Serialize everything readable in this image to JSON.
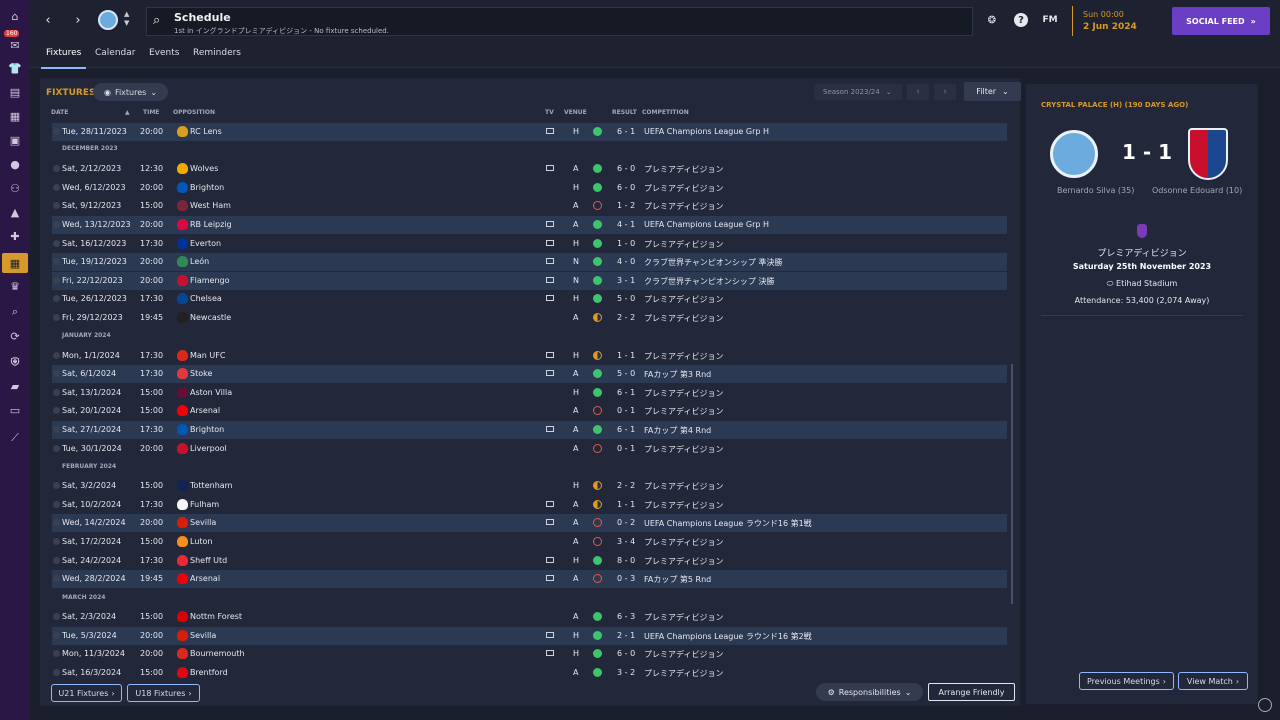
{
  "header": {
    "title": "Schedule",
    "subtitle": "1st in イングランドプレミアディビジョン - No fixture scheduled.",
    "fm_label": "FM",
    "day_time": "Sun 00:00",
    "date": "2 Jun 2024",
    "social_feed": "SOCIAL FEED",
    "inbox_badge": "160"
  },
  "tabs": [
    {
      "label": "Fixtures"
    },
    {
      "label": "Calendar"
    },
    {
      "label": "Events"
    },
    {
      "label": "Reminders"
    }
  ],
  "fixtures": {
    "title": "FIXTURES",
    "view_dropdown": "Fixtures",
    "season": "Season 2023/24",
    "filter": "Filter",
    "columns": {
      "date": "DATE",
      "time": "TIME",
      "opposition": "OPPOSITION",
      "tv": "TV",
      "venue": "VENUE",
      "result": "RESULT",
      "competition": "COMPETITION"
    },
    "months": [
      "DECEMBER 2023",
      "JANUARY 2024",
      "FEBRUARY 2024",
      "MARCH 2024"
    ],
    "rows": [
      {
        "date": "Tue, 28/11/2023",
        "time": "20:00",
        "opp": "RC Lens",
        "venue": "H",
        "result": "W",
        "score": "6 - 1",
        "comp": "UEFA Champions League Grp H"
      },
      {
        "date": "Sat, 2/12/2023",
        "time": "12:30",
        "opp": "Wolves",
        "venue": "A",
        "result": "W",
        "score": "6 - 0",
        "comp": "プレミアディビジョン"
      },
      {
        "date": "Wed, 6/12/2023",
        "time": "20:00",
        "opp": "Brighton",
        "venue": "H",
        "result": "W",
        "score": "6 - 0",
        "comp": "プレミアディビジョン"
      },
      {
        "date": "Sat, 9/12/2023",
        "time": "15:00",
        "opp": "West Ham",
        "venue": "A",
        "result": "L",
        "score": "1 - 2",
        "comp": "プレミアディビジョン"
      },
      {
        "date": "Wed, 13/12/2023",
        "time": "20:00",
        "opp": "RB Leipzig",
        "venue": "A",
        "result": "W",
        "score": "4 - 1",
        "comp": "UEFA Champions League Grp H"
      },
      {
        "date": "Sat, 16/12/2023",
        "time": "17:30",
        "opp": "Everton",
        "venue": "H",
        "result": "W",
        "score": "1 - 0",
        "comp": "プレミアディビジョン"
      },
      {
        "date": "Tue, 19/12/2023",
        "time": "20:00",
        "opp": "León",
        "venue": "N",
        "result": "W",
        "score": "4 - 0",
        "comp": "クラブ世界チャンピオンシップ 準決勝"
      },
      {
        "date": "Fri, 22/12/2023",
        "time": "20:00",
        "opp": "Flamengo",
        "venue": "N",
        "result": "W",
        "score": "3 - 1",
        "comp": "クラブ世界チャンピオンシップ 決勝"
      },
      {
        "date": "Tue, 26/12/2023",
        "time": "17:30",
        "opp": "Chelsea",
        "venue": "H",
        "result": "W",
        "score": "5 - 0",
        "comp": "プレミアディビジョン"
      },
      {
        "date": "Fri, 29/12/2023",
        "time": "19:45",
        "opp": "Newcastle",
        "venue": "A",
        "result": "D",
        "score": "2 - 2",
        "comp": "プレミアディビジョン"
      },
      {
        "date": "Mon, 1/1/2024",
        "time": "17:30",
        "opp": "Man UFC",
        "venue": "H",
        "result": "D",
        "score": "1 - 1",
        "comp": "プレミアディビジョン"
      },
      {
        "date": "Sat, 6/1/2024",
        "time": "17:30",
        "opp": "Stoke",
        "venue": "A",
        "result": "W",
        "score": "5 - 0",
        "comp": "FAカップ 第3 Rnd"
      },
      {
        "date": "Sat, 13/1/2024",
        "time": "15:00",
        "opp": "Aston Villa",
        "venue": "H",
        "result": "W",
        "score": "6 - 1",
        "comp": "プレミアディビジョン"
      },
      {
        "date": "Sat, 20/1/2024",
        "time": "15:00",
        "opp": "Arsenal",
        "venue": "A",
        "result": "L",
        "score": "0 - 1",
        "comp": "プレミアディビジョン"
      },
      {
        "date": "Sat, 27/1/2024",
        "time": "17:30",
        "opp": "Brighton",
        "venue": "A",
        "result": "W",
        "score": "6 - 1",
        "comp": "FAカップ 第4 Rnd"
      },
      {
        "date": "Tue, 30/1/2024",
        "time": "20:00",
        "opp": "Liverpool",
        "venue": "A",
        "result": "L",
        "score": "0 - 1",
        "comp": "プレミアディビジョン"
      },
      {
        "date": "Sat, 3/2/2024",
        "time": "15:00",
        "opp": "Tottenham",
        "venue": "H",
        "result": "D",
        "score": "2 - 2",
        "comp": "プレミアディビジョン"
      },
      {
        "date": "Sat, 10/2/2024",
        "time": "17:30",
        "opp": "Fulham",
        "venue": "A",
        "result": "D",
        "score": "1 - 1",
        "comp": "プレミアディビジョン"
      },
      {
        "date": "Wed, 14/2/2024",
        "time": "20:00",
        "opp": "Sevilla",
        "venue": "A",
        "result": "L",
        "score": "0 - 2",
        "comp": "UEFA Champions League ラウンド16 第1戦"
      },
      {
        "date": "Sat, 17/2/2024",
        "time": "15:00",
        "opp": "Luton",
        "venue": "A",
        "result": "L",
        "score": "3 - 4",
        "comp": "プレミアディビジョン"
      },
      {
        "date": "Sat, 24/2/2024",
        "time": "17:30",
        "opp": "Sheff Utd",
        "venue": "H",
        "result": "W",
        "score": "8 - 0",
        "comp": "プレミアディビジョン"
      },
      {
        "date": "Wed, 28/2/2024",
        "time": "19:45",
        "opp": "Arsenal",
        "venue": "A",
        "result": "L",
        "score": "0 - 3",
        "comp": "FAカップ 第5 Rnd"
      },
      {
        "date": "Sat, 2/3/2024",
        "time": "15:00",
        "opp": "Nottm Forest",
        "venue": "A",
        "result": "W",
        "score": "6 - 3",
        "comp": "プレミアディビジョン"
      },
      {
        "date": "Tue, 5/3/2024",
        "time": "20:00",
        "opp": "Sevilla",
        "venue": "H",
        "result": "W",
        "score": "2 - 1",
        "comp": "UEFA Champions League ラウンド16 第2戦"
      },
      {
        "date": "Mon, 11/3/2024",
        "time": "20:00",
        "opp": "Bournemouth",
        "venue": "H",
        "result": "W",
        "score": "6 - 0",
        "comp": "プレミアディビジョン"
      },
      {
        "date": "Sat, 16/3/2024",
        "time": "15:00",
        "opp": "Brentford",
        "venue": "A",
        "result": "W",
        "score": "3 - 2",
        "comp": "プレミアディビジョン"
      }
    ]
  },
  "footer": {
    "u21": "U21 Fixtures",
    "u18": "U18 Fixtures",
    "responsibilities": "Responsibilities",
    "arrange_friendly": "Arrange Friendly"
  },
  "side": {
    "heading": "CRYSTAL PALACE (H) (190 DAYS AGO)",
    "score": "1 - 1",
    "home_scorer": "Bernardo Silva (35)",
    "away_scorer": "Odsonne Edouard (10)",
    "competition": "プレミアディビジョン",
    "date": "Saturday 25th November 2023",
    "stadium": "Etihad Stadium",
    "attendance": "Attendance: 53,400 (2,074 Away)",
    "prev_meetings": "Previous Meetings",
    "view_match": "View Match"
  }
}
